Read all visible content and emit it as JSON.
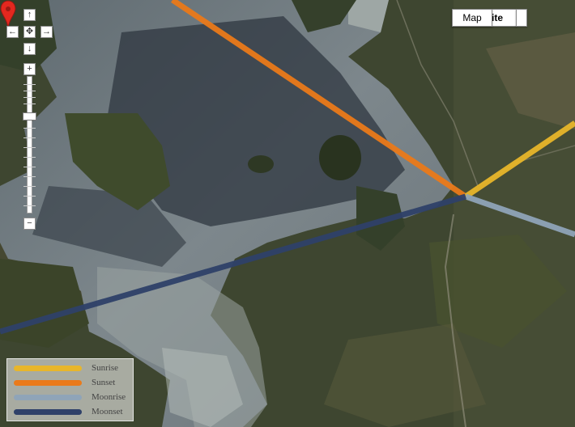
{
  "map": {
    "type_buttons": {
      "map": "Map",
      "satellite": "Satellite",
      "more": ""
    },
    "active_type": "Satellite"
  },
  "controls": {
    "up_icon": "↑",
    "left_icon": "←",
    "center_icon": "✥",
    "right_icon": "→",
    "down_icon": "↓",
    "zoom_in": "+",
    "zoom_out": "−"
  },
  "legend": {
    "items": [
      {
        "label": "Sunrise",
        "color": "#e8b62a"
      },
      {
        "label": "Sunset",
        "color": "#ea7a1a"
      },
      {
        "label": "Moonrise",
        "color": "#8fa4b8"
      },
      {
        "label": "Moonset",
        "color": "#2f4169"
      }
    ]
  },
  "marker": {
    "color": "#e3281f"
  }
}
